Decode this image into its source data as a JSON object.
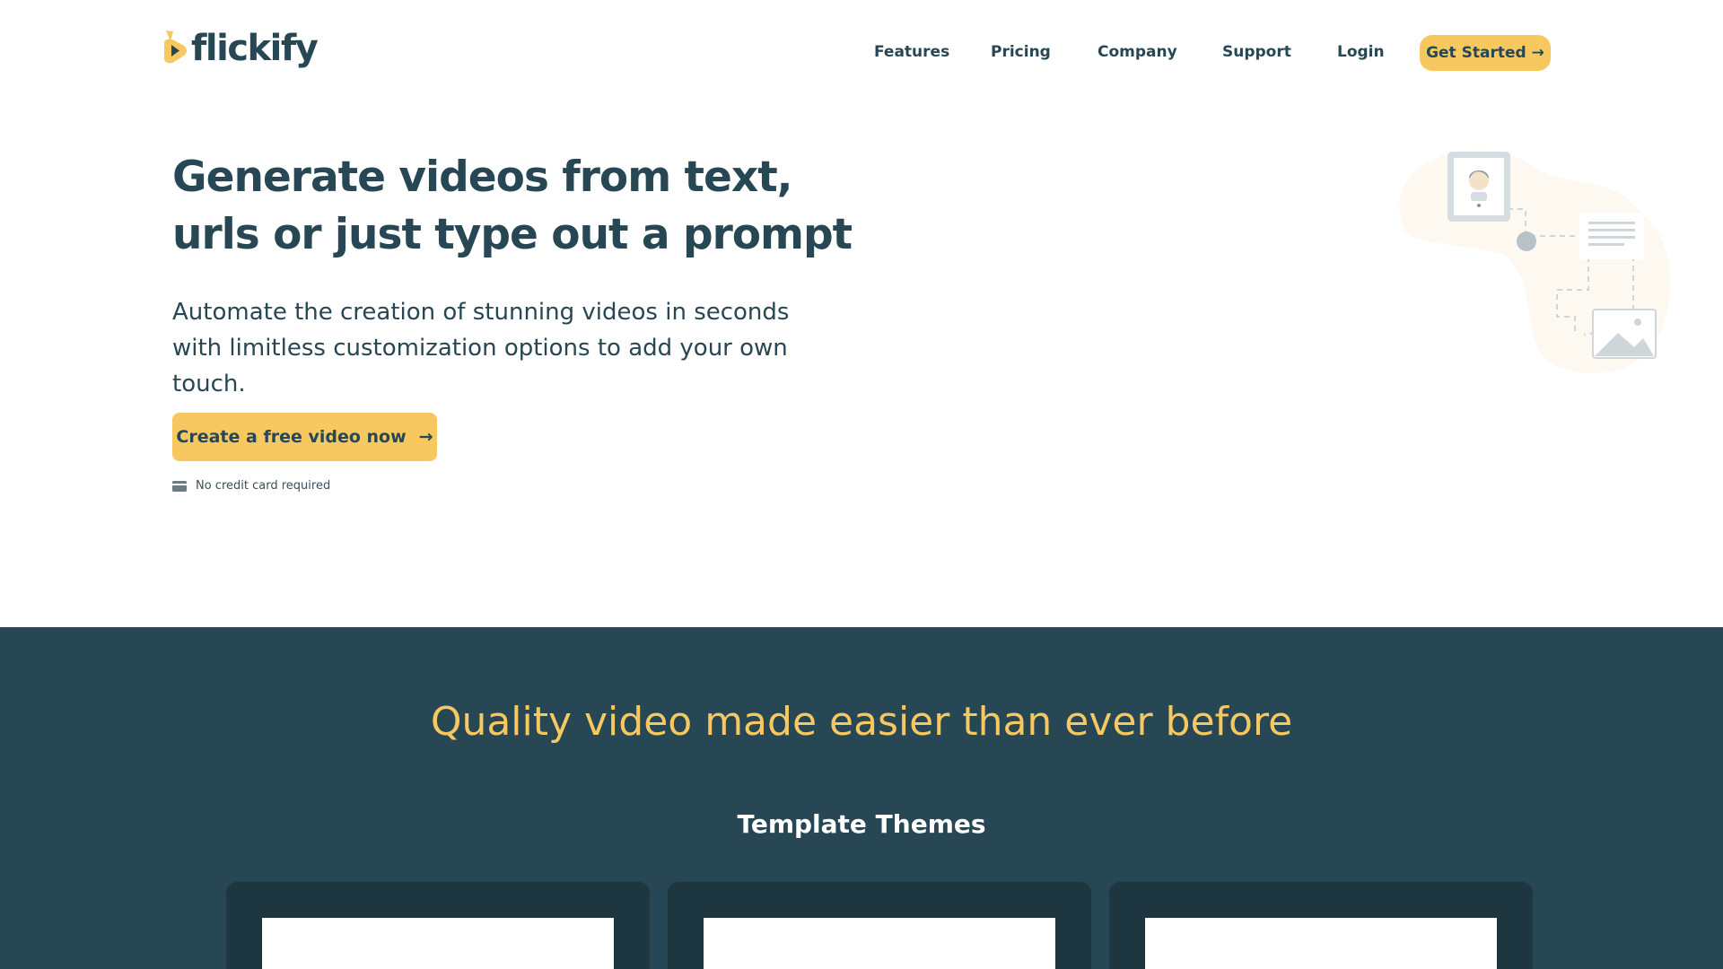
{
  "brand": {
    "name": "flickify",
    "accent": "#f6c85f",
    "primary": "#274754"
  },
  "nav": {
    "items": [
      "Features",
      "Pricing",
      "Company",
      "Support",
      "Login"
    ],
    "cta": "Get Started",
    "cta_arrow": "→"
  },
  "hero": {
    "title": "Generate videos from text, urls or just type out a prompt",
    "subtitle": "Automate the creation of stunning videos in seconds with limitless customization options to add your own touch.",
    "cta": "Create a free video now",
    "cta_arrow": "→",
    "note": "No credit card required",
    "note_icon": "credit-card-icon",
    "illustration_icons": [
      "profile-card-icon",
      "document-icon",
      "image-icon"
    ]
  },
  "section": {
    "title": "Quality video made easier than ever before",
    "subtitle": "Template Themes",
    "cards": 3
  }
}
